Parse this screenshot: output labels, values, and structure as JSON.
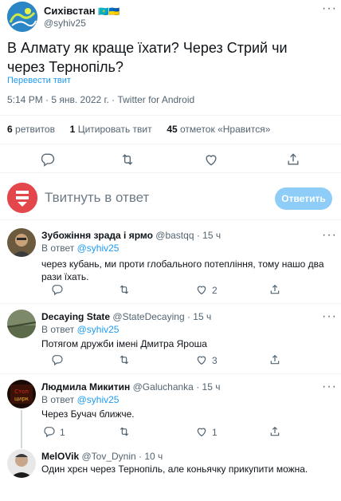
{
  "main_tweet": {
    "author_name": "Сихівстан",
    "flags": "🇰🇿🇺🇦",
    "handle": "@syhiv25",
    "text": "В Алмату як краще їхати? Через Стрий чи через Тернопіль?",
    "translate": "Перевести твит",
    "meta": "5:14 PM · 5 янв. 2022 г. · Twitter for Android",
    "stats": {
      "retweets_count": "6",
      "retweets_label": "ретвитов",
      "quotes_count": "1",
      "quotes_label": "Цитировать твит",
      "likes_count": "45",
      "likes_label": "отметок «Нравится»"
    }
  },
  "compose": {
    "placeholder": "Твитнуть в ответ",
    "button": "Ответить"
  },
  "replies": [
    {
      "name": "Зубожіння зрада і ярмо",
      "handle": "@bastqq",
      "time": "· 15 ч",
      "reply_prefix": "В ответ",
      "reply_to": "@syhiv25",
      "text": "через кубань, ми проти глобального потепління, тому нашо два рази їхать.",
      "reply_count": "",
      "retweet_count": "",
      "like_count": "2"
    },
    {
      "name": "Decaying State",
      "handle": "@StateDecaying",
      "time": "· 15 ч",
      "reply_prefix": "В ответ",
      "reply_to": "@syhiv25",
      "text": "Потягом дружби імені Дмитра Яроша",
      "reply_count": "",
      "retweet_count": "",
      "like_count": "3"
    },
    {
      "name": "Людмила Микитин",
      "handle": "@Galuchanka",
      "time": "· 15 ч",
      "reply_prefix": "В ответ",
      "reply_to": "@syhiv25",
      "text": "Через Бучач ближче.",
      "reply_count": "1",
      "retweet_count": "",
      "like_count": "1"
    },
    {
      "name": "MelOVik",
      "handle": "@Tov_Dynin",
      "time": "· 10 ч",
      "text": "Один хрєн через Тернопіль, але коньячку прикупити можна."
    }
  ],
  "avatar4_text": "Стоп\nцирк",
  "colors": {
    "accent": "#1d9bf0",
    "button_disabled": "#8ecdf8",
    "text": "#0f1419",
    "muted": "#536471"
  },
  "icons": [
    "more-icon",
    "reply-icon",
    "retweet-icon",
    "like-icon",
    "share-icon"
  ]
}
